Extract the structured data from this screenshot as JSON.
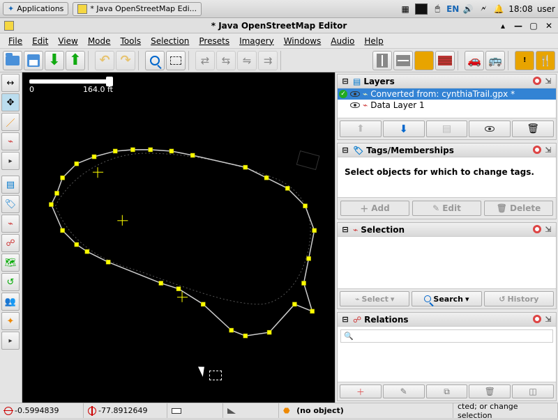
{
  "taskbar": {
    "apps_label": "Applications",
    "task_label": "* Java OpenStreetMap Edi...",
    "lang": "EN",
    "clock": "18:08",
    "user": "user"
  },
  "window": {
    "title": "* Java OpenStreetMap Editor"
  },
  "menus": {
    "file": "File",
    "edit": "Edit",
    "view": "View",
    "mode": "Mode",
    "tools": "Tools",
    "selection": "Selection",
    "presets": "Presets",
    "imagery": "Imagery",
    "windows": "Windows",
    "audio": "Audio",
    "help": "Help"
  },
  "scale": {
    "start": "0",
    "end": "164.0 ft"
  },
  "panels": {
    "layers": {
      "title": "Layers",
      "items": [
        {
          "label": "Converted from: cynthiaTrail.gpx *",
          "active": true
        },
        {
          "label": "Data Layer 1",
          "active": false
        }
      ]
    },
    "tags": {
      "title": "Tags/Memberships",
      "empty_msg": "Select objects for which to change tags.",
      "add": "Add",
      "edit": "Edit",
      "delete": "Delete"
    },
    "selection": {
      "title": "Selection",
      "select_btn": "Select",
      "search_btn": "Search",
      "history_btn": "History"
    },
    "relations": {
      "title": "Relations",
      "search_placeholder": ""
    }
  },
  "statusbar": {
    "lat": "-0.5994839",
    "lon": "-77.8912649",
    "dist": "",
    "angle": "",
    "hover_name": "(no object)",
    "hint_tail": "cted; or change selection"
  }
}
